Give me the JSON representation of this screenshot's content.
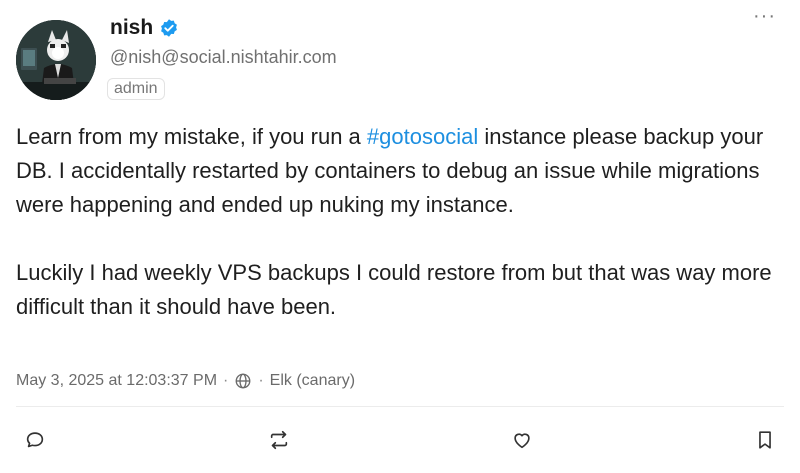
{
  "author": {
    "display_name": "nish",
    "verified": true,
    "handle": "@nish@social.nishtahir.com",
    "role_badge": "admin",
    "avatar_icon": "cat-hacker-avatar"
  },
  "post": {
    "paragraph1_before": "Learn from my mistake, if you run a ",
    "hashtag": "#gotosocial",
    "paragraph1_after": " instance please backup your DB. I accidentally restarted by containers to debug an issue while migrations were happening and ended up nuking my instance.",
    "paragraph2": "Luckily I had weekly VPS backups I could restore from but that was way more difficult than it should have been."
  },
  "meta": {
    "timestamp": "May 3, 2025 at 12:03:37 PM",
    "separator": "·",
    "visibility_icon": "globe-icon",
    "client": "Elk (canary)"
  },
  "menu": {
    "more_label": "···"
  },
  "actions": [
    "reply-icon",
    "boost-icon",
    "favourite-icon",
    "bookmark-icon"
  ],
  "colors": {
    "accent": "#1d8fe0",
    "verified": "#1d9bf0",
    "muted_text": "#6b6b6b"
  }
}
